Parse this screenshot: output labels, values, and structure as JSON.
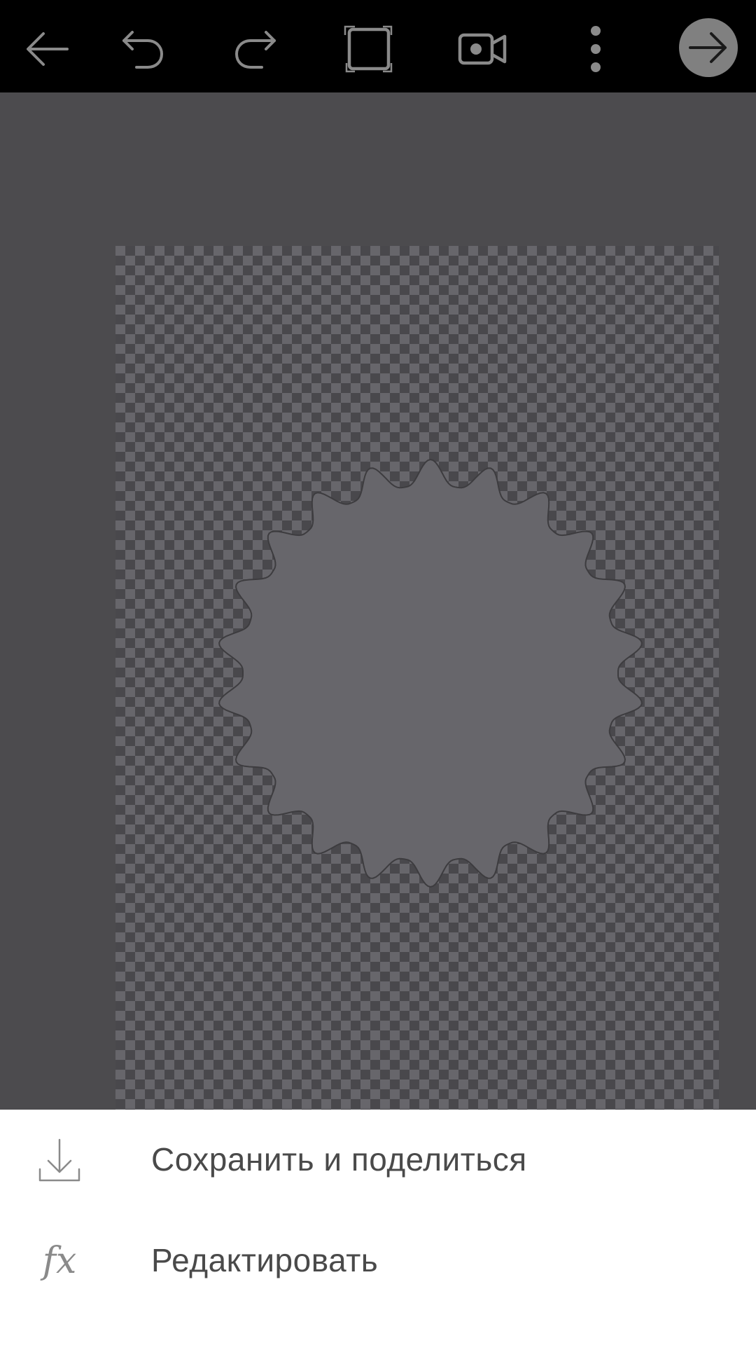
{
  "toolbar": {
    "back_icon": "arrow-left-icon",
    "undo_icon": "undo-icon",
    "redo_icon": "redo-icon",
    "fullscreen_icon": "crop-frame-icon",
    "video_icon": "video-camera-icon",
    "more_icon": "more-vertical-icon",
    "next_icon": "arrow-right-icon"
  },
  "canvas": {
    "background": "transparent-checkerboard",
    "shape": "starburst-badge",
    "shape_color": "#67666b"
  },
  "bottom_sheet": {
    "items": [
      {
        "icon": "download-icon",
        "label": "Сохранить и поделиться"
      },
      {
        "icon": "fx-icon",
        "glyph": "fx",
        "label": "Редактировать"
      }
    ]
  },
  "colors": {
    "toolbar_bg": "#000000",
    "icon_gray": "#8a8a8a",
    "workspace_bg": "#4c4b4e",
    "sheet_bg": "#ffffff",
    "next_button_bg": "#808080"
  }
}
